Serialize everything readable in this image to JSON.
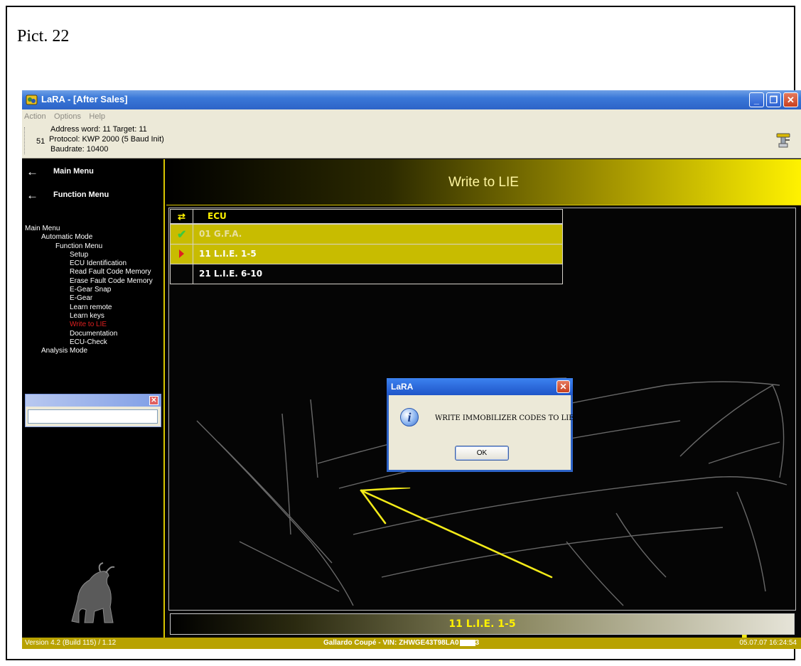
{
  "caption": "Pict. 22",
  "window": {
    "title": "LaRA - [After Sales]",
    "minimize": "_",
    "restore": "❐",
    "close": "✕"
  },
  "menu": [
    "Action",
    "Options",
    "Help"
  ],
  "info": {
    "ecu_number": "51",
    "line1": "Address word: 11   Target: 11",
    "line2": "Protocol: KWP 2000 (5 Baud Init)",
    "line3": "Baudrate: 10400"
  },
  "nav": {
    "main_menu": "Main Menu",
    "function_menu": "Function Menu",
    "arrow": "←"
  },
  "tree": [
    {
      "label": "Main Menu",
      "indent": 0
    },
    {
      "label": "Automatic Mode",
      "indent": 1
    },
    {
      "label": "Function Menu",
      "indent": 2
    },
    {
      "label": "Setup",
      "indent": 3
    },
    {
      "label": "ECU Identification",
      "indent": 3
    },
    {
      "label": "Read Fault Code Memory",
      "indent": 3
    },
    {
      "label": "Erase Fault Code Memory",
      "indent": 3
    },
    {
      "label": "E-Gear Snap",
      "indent": 3
    },
    {
      "label": "E-Gear",
      "indent": 3
    },
    {
      "label": "Learn remote",
      "indent": 3
    },
    {
      "label": "Learn keys",
      "indent": 3
    },
    {
      "label": "Write to LIE",
      "indent": 3,
      "active": true
    },
    {
      "label": "Documentation",
      "indent": 3
    },
    {
      "label": "ECU-Check",
      "indent": 3
    },
    {
      "label": "Analysis Mode",
      "indent": 1
    }
  ],
  "page_title": "Write to LIE",
  "table": {
    "header": "ECU",
    "header_icon": "⇄",
    "rows": [
      {
        "label": "01  G.F.A.",
        "status": "check",
        "selected": true,
        "dim": true
      },
      {
        "label": "11  L.I.E. 1-5",
        "status": "play",
        "selected": true,
        "dim": false
      },
      {
        "label": "21  L.I.E. 6-10",
        "status": "",
        "selected": false,
        "dim": false
      }
    ]
  },
  "dialog": {
    "title": "LaRA",
    "message": "WRITE IMMOBILIZER CODES TO LIE",
    "ok": "OK",
    "close": "✕",
    "icon": "i"
  },
  "annotation": "ok",
  "selected_ecu": "11  L.I.E. 1-5",
  "status": {
    "version": "Version 4.2 (Build 115) / 1.12",
    "vehicle_prefix": "Gallardo Coupé   -   VIN: ZHWGE43T98LA0",
    "vehicle_suffix": "3",
    "datetime": "05.07.07 16:24:54"
  },
  "colors": {
    "accent_yellow": "#fff200",
    "xp_blue": "#2d63c7",
    "active_red": "#e02020",
    "status_gold": "#b8a200"
  }
}
